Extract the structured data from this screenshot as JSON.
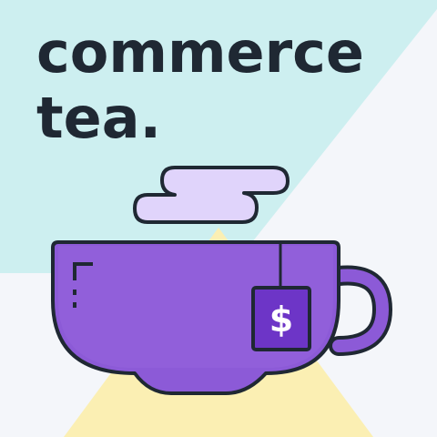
{
  "brand": {
    "title_line1": "commerce",
    "title_line2": "tea.",
    "tag_symbol": "$"
  },
  "icons": {
    "steam": "steam-cloud-icon",
    "mug": "tea-mug-icon",
    "tag": "tea-bag-tag-icon"
  },
  "colors": {
    "background_light": "#f4f6fa",
    "background_cyan": "#cdeff0",
    "background_yellow": "#fbefb3",
    "mug_purple": "#8c5ad7",
    "mug_purple_light": "#9b6be0",
    "steam_lavender": "#e0d4fb",
    "outline": "#1f2833",
    "tag_purple": "#6d35c7",
    "text_dark": "#1f2833"
  }
}
